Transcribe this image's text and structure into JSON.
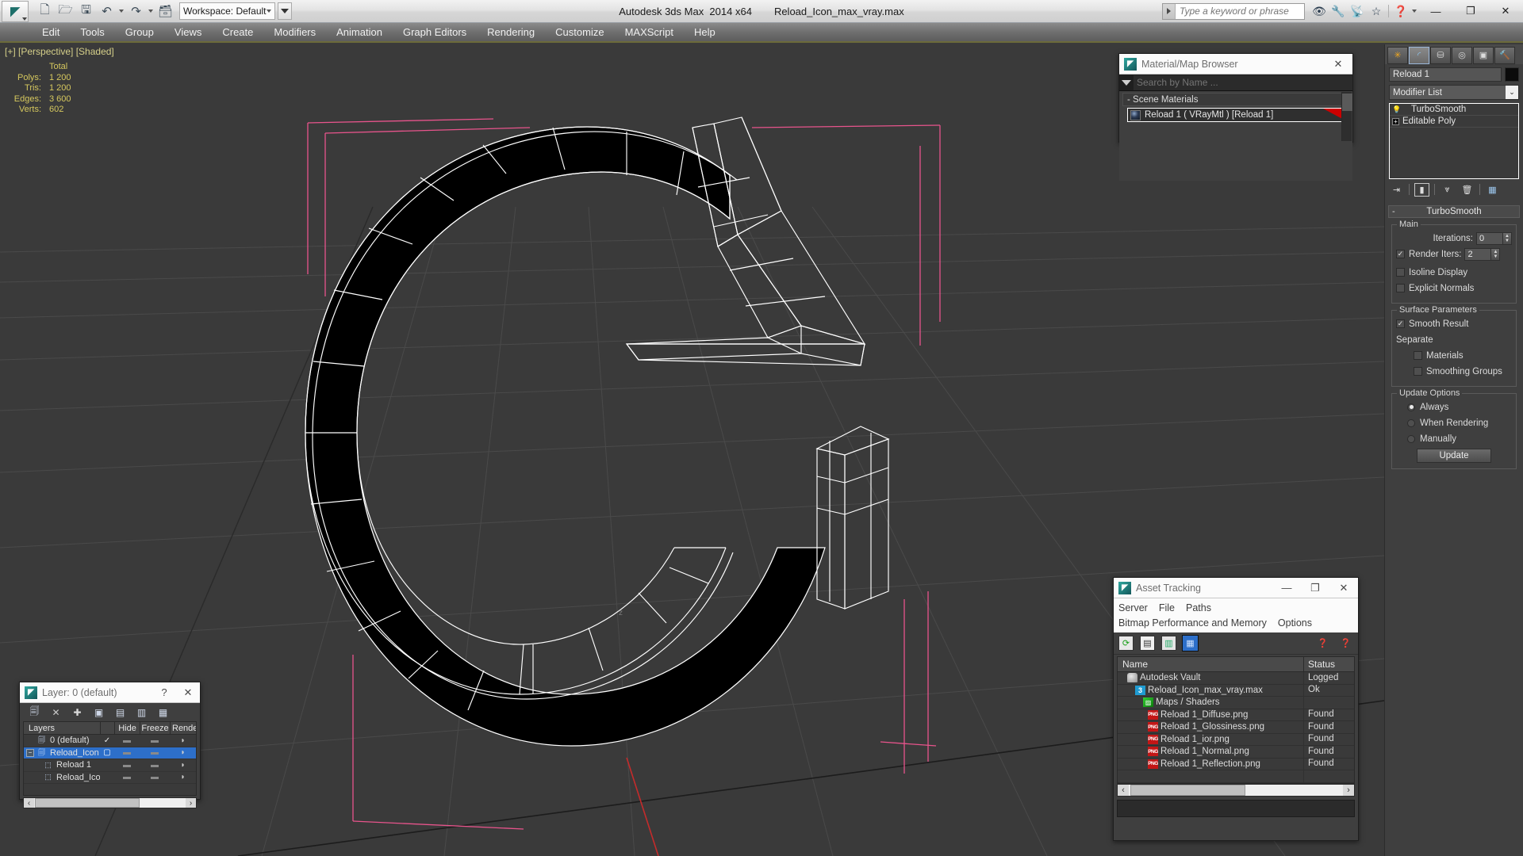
{
  "titlebar": {
    "logo_glyph": "◤",
    "app_title": "Autodesk 3ds Max  2014 x64",
    "file_title": "Reload_Icon_max_vray.max",
    "workspace_label": "Workspace: Default",
    "quick_access": [
      {
        "name": "new-file-icon",
        "glyph": "🗋"
      },
      {
        "name": "open-file-icon",
        "glyph": "🗁"
      },
      {
        "name": "save-file-icon",
        "glyph": "🖫"
      },
      {
        "name": "undo-icon",
        "glyph": "↩"
      },
      {
        "name": "redo-icon",
        "glyph": "↪"
      },
      {
        "name": "project-folder-icon",
        "glyph": "🗂"
      }
    ],
    "search_placeholder": "Type a keyword or phrase",
    "right_icons": [
      {
        "name": "binoculars-icon",
        "glyph": "👓"
      },
      {
        "name": "wrench-icon",
        "glyph": "🔧"
      },
      {
        "name": "satellite-dish-icon",
        "glyph": "📡"
      },
      {
        "name": "favorites-star-icon",
        "glyph": "★"
      },
      {
        "name": "help-icon",
        "glyph": "?"
      }
    ],
    "window_controls": {
      "minimize": "—",
      "maximize": "❐",
      "close": "✕"
    }
  },
  "menubar": {
    "items": [
      "Edit",
      "Tools",
      "Group",
      "Views",
      "Create",
      "Modifiers",
      "Animation",
      "Graph Editors",
      "Rendering",
      "Customize",
      "MAXScript",
      "Help"
    ]
  },
  "viewport": {
    "label": "[+] [Perspective] [Shaded]",
    "stats": {
      "header": "Total",
      "rows": [
        {
          "label": "Polys:",
          "value": "1 200"
        },
        {
          "label": "Tris:",
          "value": "1 200"
        },
        {
          "label": "Edges:",
          "value": "3 600"
        },
        {
          "label": "Verts:",
          "value": "602"
        }
      ]
    },
    "colors": {
      "background": "#3a3a3a",
      "grid": "#4a4a4a",
      "wireframe": "#ffffff",
      "selection_bracket": "#e8548c",
      "axis_red": "#cc2222",
      "stats_text": "#d6c85e"
    }
  },
  "material_browser": {
    "title": "Material/Map Browser",
    "close_label": "✕",
    "search_placeholder": "Search by Name ...",
    "group_label": "- Scene Materials",
    "material": {
      "name": "Reload 1  ( VRayMtl )  [Reload 1]",
      "tag_color": "#cc0000"
    }
  },
  "asset_tracking": {
    "title": "Asset Tracking",
    "window_controls": {
      "minimize": "—",
      "maximize": "❐",
      "close": "✕"
    },
    "menus_row1": [
      "Server",
      "File",
      "Paths"
    ],
    "menus_row2": [
      "Bitmap Performance and Memory",
      "Options"
    ],
    "toolbar": [
      {
        "name": "refresh-icon",
        "glyph": "⟳",
        "selected": false
      },
      {
        "name": "list-view-icon",
        "glyph": "▤",
        "selected": false
      },
      {
        "name": "detail-view-icon",
        "glyph": "▥",
        "selected": false
      },
      {
        "name": "grid-view-icon",
        "glyph": "▦",
        "selected": true
      }
    ],
    "toolbar_right": [
      {
        "name": "add-help-icon",
        "glyph": "❓"
      },
      {
        "name": "query-icon",
        "glyph": "❓"
      }
    ],
    "columns": [
      "Name",
      "Status"
    ],
    "rows": [
      {
        "icon": "vault-icon",
        "icon_class": "ico-vault",
        "icon_text": "",
        "indent": 1,
        "name": "Autodesk Vault",
        "status": "Logged"
      },
      {
        "icon": "max-file-icon",
        "icon_class": "ico-max",
        "icon_text": "3",
        "indent": 2,
        "name": "Reload_Icon_max_vray.max",
        "status": "Ok"
      },
      {
        "icon": "maps-shaders-icon",
        "icon_class": "ico-maps",
        "icon_text": "▨",
        "indent": 3,
        "name": "Maps / Shaders",
        "status": ""
      },
      {
        "icon": "png-file-icon",
        "icon_class": "ico-png",
        "icon_text": "PNG",
        "indent": 4,
        "name": "Reload 1_Diffuse.png",
        "status": "Found"
      },
      {
        "icon": "png-file-icon",
        "icon_class": "ico-png",
        "icon_text": "PNG",
        "indent": 4,
        "name": "Reload 1_Glossiness.png",
        "status": "Found"
      },
      {
        "icon": "png-file-icon",
        "icon_class": "ico-png",
        "icon_text": "PNG",
        "indent": 4,
        "name": "Reload 1_ior.png",
        "status": "Found"
      },
      {
        "icon": "png-file-icon",
        "icon_class": "ico-png",
        "icon_text": "PNG",
        "indent": 4,
        "name": "Reload 1_Normal.png",
        "status": "Found"
      },
      {
        "icon": "png-file-icon",
        "icon_class": "ico-png",
        "icon_text": "PNG",
        "indent": 4,
        "name": "Reload 1_Reflection.png",
        "status": "Found"
      }
    ],
    "scroll_left": "‹",
    "scroll_right": "›"
  },
  "layer_dialog": {
    "title": "Layer: 0 (default)",
    "help_label": "?",
    "close_label": "✕",
    "toolbar": [
      {
        "name": "create-new-layer-icon",
        "glyph": "▤"
      },
      {
        "name": "delete-layer-icon",
        "glyph": "✕"
      },
      {
        "name": "add-to-layer-icon",
        "glyph": "✚"
      },
      {
        "name": "select-objects-in-layer-icon",
        "glyph": "▣"
      },
      {
        "name": "select-highlighted-objects-icon",
        "glyph": "▤"
      },
      {
        "name": "highlight-selected-objects-icon",
        "glyph": "▤"
      },
      {
        "name": "hide-unhide-layer-icon",
        "glyph": "▤"
      }
    ],
    "columns": [
      "Layers",
      "",
      "Hide",
      "Freeze",
      "Rende"
    ],
    "rows": [
      {
        "name": "0 (default)",
        "indent": 1,
        "expander": false,
        "icon": "layer-icon",
        "active_mark": "✓",
        "hide": "▭",
        "freeze": "▭",
        "render": "◗",
        "selected": false
      },
      {
        "name": "Reload_Icon",
        "indent": 0,
        "expander": true,
        "icon": "layer-icon",
        "active_mark": "▢",
        "hide": "▭",
        "freeze": "▭",
        "render": "◗",
        "selected": true
      },
      {
        "name": "Reload 1",
        "indent": 2,
        "expander": false,
        "icon": "object-icon",
        "active_mark": "",
        "hide": "▭",
        "freeze": "▭",
        "render": "◗",
        "selected": false
      },
      {
        "name": "Reload_Icon",
        "indent": 2,
        "expander": false,
        "icon": "object-icon",
        "active_mark": "",
        "hide": "▭",
        "freeze": "▭",
        "render": "◗",
        "selected": false
      }
    ],
    "scroll_left": "‹",
    "scroll_right": "›"
  },
  "command_panel": {
    "tabs": [
      {
        "name": "create-tab",
        "glyph": "✳",
        "active": false
      },
      {
        "name": "modify-tab",
        "glyph": "◜",
        "active": true
      },
      {
        "name": "hierarchy-tab",
        "glyph": "⛁",
        "active": false
      },
      {
        "name": "motion-tab",
        "glyph": "◎",
        "active": false
      },
      {
        "name": "display-tab",
        "glyph": "▣",
        "active": false
      },
      {
        "name": "utilities-tab",
        "glyph": "🔨",
        "active": false
      }
    ],
    "object_name": "Reload 1",
    "object_color": "#0b0b0b",
    "modifier_list_label": "Modifier List",
    "stack": [
      {
        "name": "TurboSmooth",
        "type": "modifier",
        "has_plus": false,
        "bulb": "💡"
      },
      {
        "name": "Editable Poly",
        "type": "base",
        "has_plus": true,
        "bulb": ""
      }
    ],
    "stack_buttons": [
      {
        "name": "pin-stack-icon",
        "glyph": "⇥",
        "boxed": false
      },
      {
        "name": "show-end-result-icon",
        "glyph": "▮",
        "boxed": true
      },
      {
        "name": "make-unique-icon",
        "glyph": "⩒",
        "boxed": false
      },
      {
        "name": "remove-modifier-icon",
        "glyph": "🗑",
        "boxed": false
      },
      {
        "name": "configure-modifier-sets-icon",
        "glyph": "▦",
        "boxed": false
      }
    ],
    "rollout": {
      "title": "TurboSmooth",
      "collapse_glyph": "-",
      "groups": [
        {
          "label": "Main",
          "fields": [
            {
              "kind": "spinner",
              "label": "Iterations:",
              "value": "0",
              "checkbox": null
            },
            {
              "kind": "spinner",
              "label": "Render Iters:",
              "value": "2",
              "checkbox": true
            },
            {
              "kind": "checkbox",
              "label": "Isoline Display",
              "checked": false
            },
            {
              "kind": "checkbox",
              "label": "Explicit Normals",
              "checked": false
            }
          ]
        },
        {
          "label": "Surface Parameters",
          "fields": [
            {
              "kind": "checkbox",
              "label": "Smooth Result",
              "checked": true
            },
            {
              "kind": "text",
              "label": "Separate"
            },
            {
              "kind": "checkbox-indent",
              "label": "Materials",
              "checked": false
            },
            {
              "kind": "checkbox-indent",
              "label": "Smoothing Groups",
              "checked": false
            }
          ]
        },
        {
          "label": "Update Options",
          "fields": [
            {
              "kind": "radio",
              "label": "Always",
              "checked": true
            },
            {
              "kind": "radio",
              "label": "When Rendering",
              "checked": false
            },
            {
              "kind": "radio",
              "label": "Manually",
              "checked": false
            }
          ],
          "button": "Update"
        }
      ]
    }
  }
}
